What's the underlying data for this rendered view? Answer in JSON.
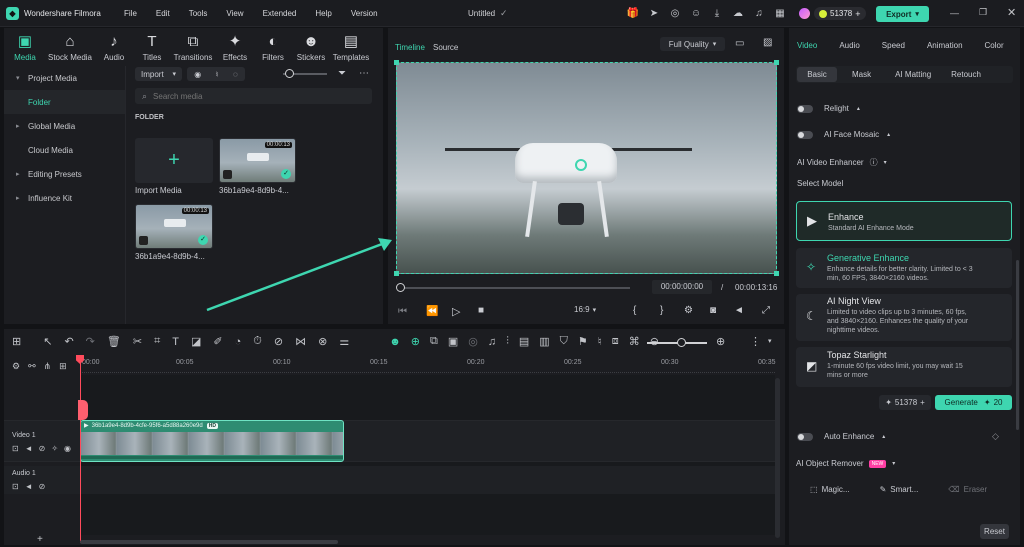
{
  "app": {
    "name": "Wondershare Filmora",
    "project_title": "Untitled",
    "credits": "51378",
    "export_label": "Export"
  },
  "menu": [
    "File",
    "Edit",
    "Tools",
    "View",
    "Extended",
    "Help",
    "Version"
  ],
  "toolbar": [
    {
      "label": "Media",
      "icon": "media-icon"
    },
    {
      "label": "Stock Media",
      "icon": "stock-media-icon"
    },
    {
      "label": "Audio",
      "icon": "audio-icon"
    },
    {
      "label": "Titles",
      "icon": "titles-icon"
    },
    {
      "label": "Transitions",
      "icon": "transitions-icon"
    },
    {
      "label": "Effects",
      "icon": "effects-icon"
    },
    {
      "label": "Filters",
      "icon": "filters-icon"
    },
    {
      "label": "Stickers",
      "icon": "stickers-icon"
    },
    {
      "label": "Templates",
      "icon": "templates-icon"
    }
  ],
  "sidebar": {
    "items": [
      {
        "label": "Project Media",
        "arrow": "▾"
      },
      {
        "label": "Folder",
        "arrow": ""
      },
      {
        "label": "Global Media",
        "arrow": "▸"
      },
      {
        "label": "Cloud Media",
        "arrow": ""
      },
      {
        "label": "Editing Presets",
        "arrow": "▸"
      },
      {
        "label": "Influence Kit",
        "arrow": "▸"
      }
    ]
  },
  "media": {
    "import_label": "Import",
    "search_placeholder": "Search media",
    "folder_heading": "FOLDER",
    "import_tile_label": "Import Media",
    "clips": [
      {
        "name": "36b1a9e4-8d9b-4...",
        "duration": "00:00:13"
      },
      {
        "name": "36b1a9e4-8d9b-4...",
        "duration": "00:00:13"
      }
    ]
  },
  "preview": {
    "tabs": [
      "Timeline",
      "Source"
    ],
    "quality": "Full Quality",
    "current_time": "00:00:00:00",
    "separator": "/",
    "total_time": "00:00:13:16",
    "aspect": "16:9"
  },
  "right": {
    "tabs": [
      "Video",
      "Audio",
      "Speed",
      "Animation",
      "Color"
    ],
    "subtabs": [
      "Basic",
      "Mask",
      "AI Matting",
      "Retouch"
    ],
    "relight": "Relight",
    "face_mosaic": "AI Face Mosaic",
    "enhancer_title": "AI Video Enhancer",
    "select_model": "Select Model",
    "models": [
      {
        "title": "Enhance",
        "desc": "Standard AI Enhance Mode"
      },
      {
        "title": "Generative Enhance",
        "desc": "Enhance details for better clarity. Limited to < 3 min, 60 FPS, 3840×2160 videos."
      },
      {
        "title": "AI Night View",
        "desc": "Limited to video clips up to 3 minutes, 60 fps, and 3840×2160. Enhances the quality of your nighttime videos."
      },
      {
        "title": "Topaz Starlight",
        "desc": "1-minute 60 fps video limit, you may wait 15 mins or more"
      }
    ],
    "credits": "51378",
    "generate_label": "Generate",
    "generate_cost": "20",
    "auto_enhance": "Auto Enhance",
    "object_remover": "AI Object Remover",
    "new_badge": "NEW",
    "remover_tools": [
      "Magic...",
      "Smart...",
      "Eraser"
    ],
    "reset_label": "Reset"
  },
  "timeline": {
    "ruler": [
      "00:00",
      "00:05",
      "00:10",
      "00:15",
      "00:20",
      "00:25",
      "00:30",
      "00:35"
    ],
    "tracks": [
      {
        "label": "Video 1"
      },
      {
        "label": "Audio 1"
      }
    ],
    "clip_name": "36b1a9e4-8d9b-4cfe-95f6-a5d88a260e9d",
    "clip_badge": "HD"
  },
  "colors": {
    "accent": "#3ed6b0",
    "clip": "#2e8c72"
  }
}
